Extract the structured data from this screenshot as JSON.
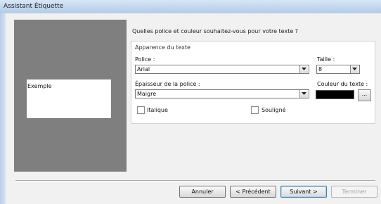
{
  "window": {
    "title": "Assistant Étiquette"
  },
  "preview": {
    "sample_text": "Exemple",
    "panel_color": "#7f7f7f"
  },
  "main": {
    "question": "Quelles police et couleur souhaitez-vous pour votre texte ?",
    "group_title": "Apparence du texte",
    "font": {
      "label": "Police :",
      "value": "Arial"
    },
    "size": {
      "label": "Taille :",
      "value": "8"
    },
    "weight": {
      "label": "Épaisseur de la police :",
      "value": "Maigre"
    },
    "color": {
      "label": "Couleur du texte :",
      "value": "#000000",
      "button_label": "..."
    },
    "italic": {
      "label": "Italique",
      "checked": false
    },
    "underline": {
      "label": "Souligné",
      "checked": false
    }
  },
  "footer": {
    "cancel": "Annuler",
    "previous": "< Précédent",
    "next": "Suivant >",
    "finish": "Terminer"
  }
}
